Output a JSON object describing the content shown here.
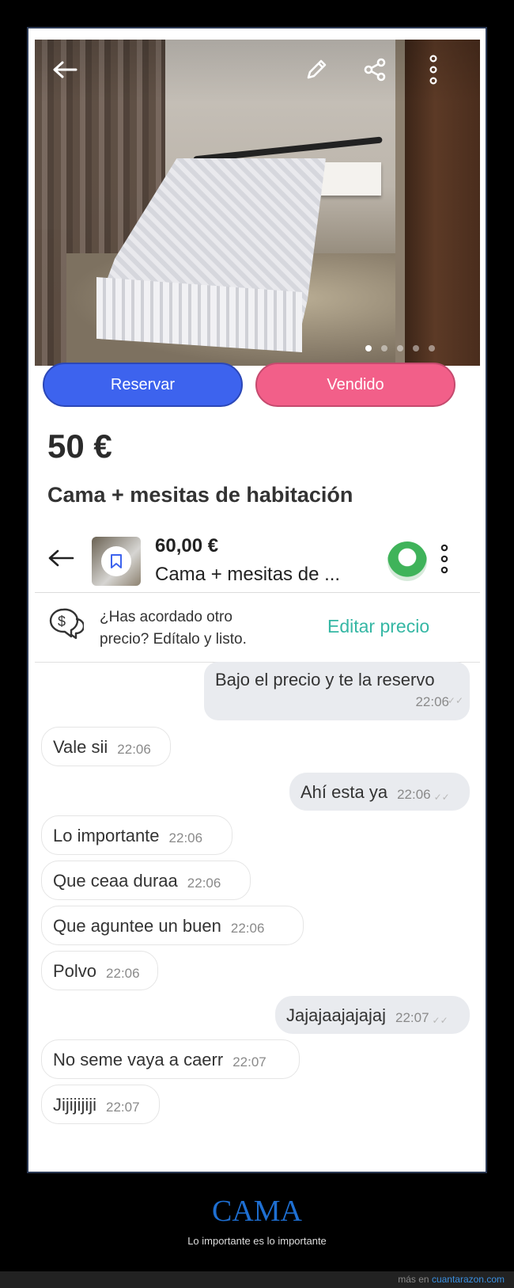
{
  "listing": {
    "reserve_label": "Reservar",
    "sold_label": "Vendido",
    "price": "50 €",
    "title": "Cama + mesitas de habitación",
    "photo_count": 5,
    "photo_active_index": 0
  },
  "chat_header": {
    "price": "60,00 €",
    "title": "Cama + mesitas de ..."
  },
  "banner": {
    "text": "¿Has acordado otro precio? Edítalo y listo.",
    "link": "Editar precio"
  },
  "messages": [
    {
      "dir": "out",
      "text": "Bajo el precio y te la reservo",
      "time": "22:06"
    },
    {
      "dir": "in",
      "text": "Vale sii",
      "time": "22:06"
    },
    {
      "dir": "out",
      "text": "Ahí esta ya",
      "time": "22:06"
    },
    {
      "dir": "in",
      "text": "Lo importante",
      "time": "22:06"
    },
    {
      "dir": "in",
      "text": "Que ceaa duraa",
      "time": "22:06"
    },
    {
      "dir": "in",
      "text": "Que aguntee un buen",
      "time": "22:06"
    },
    {
      "dir": "in",
      "text": "Polvo",
      "time": "22:06"
    },
    {
      "dir": "out",
      "text": "Jajajaajajajaj",
      "time": "22:07"
    },
    {
      "dir": "in",
      "text": "No seme vaya a caerr",
      "time": "22:07"
    },
    {
      "dir": "in",
      "text": "Jijijijiji",
      "time": "22:07"
    }
  ],
  "caption": {
    "title": "CAMA",
    "subtitle": "Lo importante es lo importante"
  },
  "footer": {
    "prefix": "más en ",
    "site": "cuantarazon.com"
  },
  "colors": {
    "reserve": "#3d63ee",
    "sold": "#f25f89",
    "link": "#35b7a4",
    "caption": "#1e6fd2"
  }
}
